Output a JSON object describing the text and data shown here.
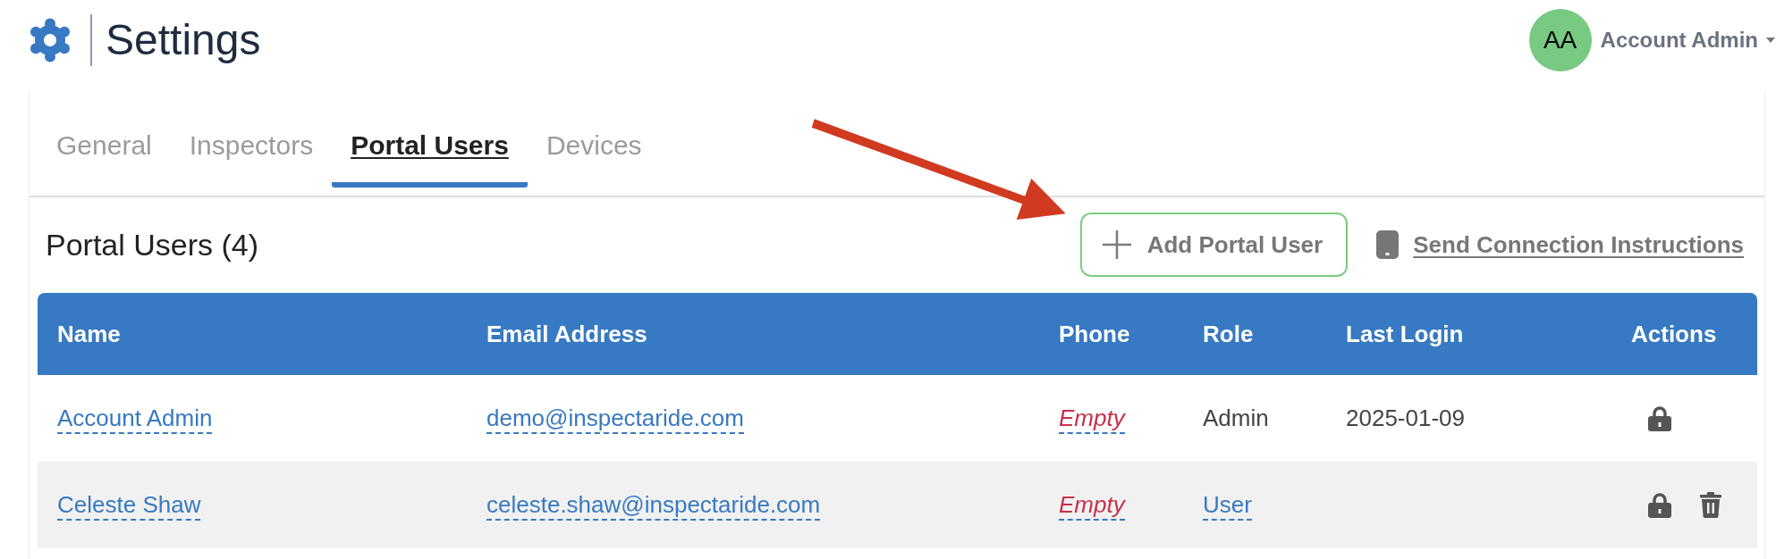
{
  "header": {
    "title": "Settings"
  },
  "account": {
    "initials": "AA",
    "name": "Account Admin"
  },
  "tabs": [
    {
      "label": "General",
      "selected": false
    },
    {
      "label": "Inspectors",
      "selected": false
    },
    {
      "label": "Portal Users",
      "selected": true
    },
    {
      "label": "Devices",
      "selected": false
    }
  ],
  "section": {
    "title": "Portal Users (4)",
    "add_button": "Add Portal User",
    "send_link": "Send Connection Instructions"
  },
  "table": {
    "columns": [
      "Name",
      "Email Address",
      "Phone",
      "Role",
      "Last Login",
      "Actions"
    ],
    "rows": [
      {
        "name": {
          "text": "Account Admin",
          "kind": "link"
        },
        "email": {
          "text": "demo@inspectaride.com",
          "kind": "link"
        },
        "phone": {
          "text": "Empty",
          "kind": "unset"
        },
        "role": {
          "text": "Admin",
          "kind": "plain"
        },
        "last_login": {
          "text": "2025-01-09",
          "kind": "plain"
        },
        "can_delete": false
      },
      {
        "name": {
          "text": "Celeste Shaw",
          "kind": "link"
        },
        "email": {
          "text": "celeste.shaw@inspectaride.com",
          "kind": "link"
        },
        "phone": {
          "text": "Empty",
          "kind": "unset"
        },
        "role": {
          "text": "User",
          "kind": "link"
        },
        "can_delete": true
      }
    ]
  }
}
